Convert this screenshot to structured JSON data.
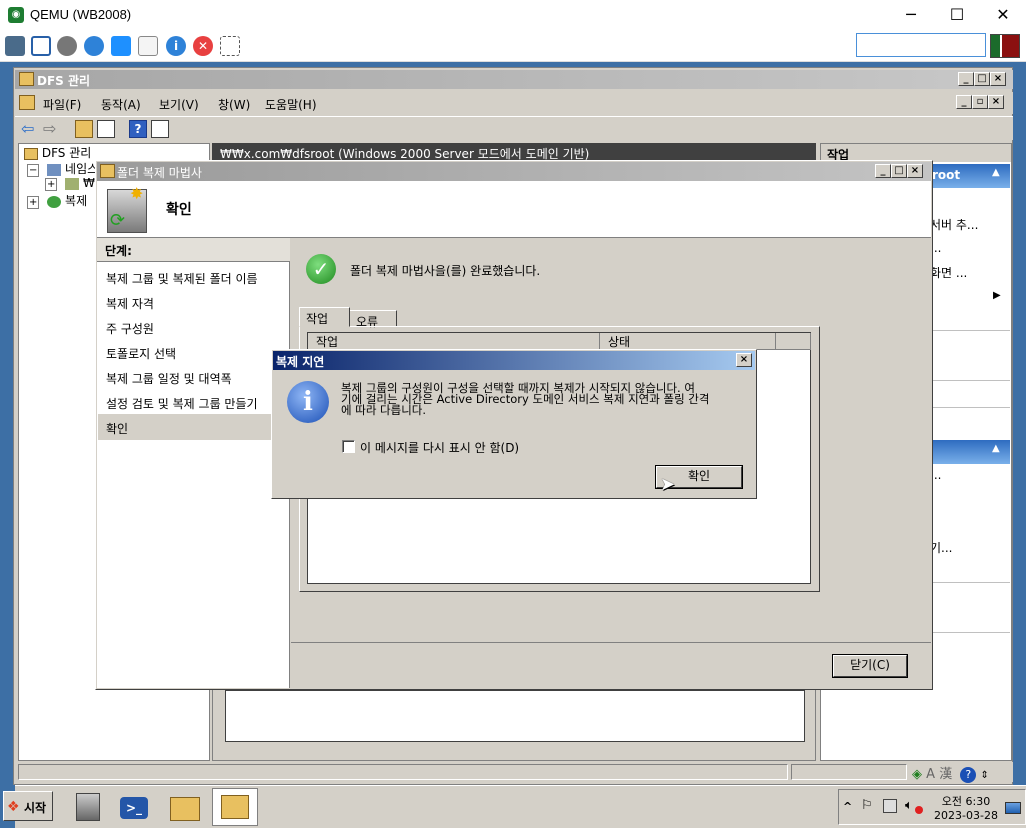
{
  "qemu": {
    "title": "QEMU (WB2008)",
    "window_controls": [
      "─",
      "☐",
      "✕"
    ],
    "toolbar_icons": [
      "network-icon",
      "fullscreen-icon",
      "settings-icon",
      "refresh-icon",
      "windows-icon",
      "usb-icon",
      "info-icon",
      "stop-icon",
      "screenshot-icon"
    ],
    "search_value": ""
  },
  "mmc": {
    "title": "DFS 관리",
    "menu": [
      "파일(F)",
      "동작(A)",
      "보기(V)",
      "창(W)",
      "도움말(H)"
    ],
    "tree": {
      "root": "DFS 관리",
      "namespaces": "네임스",
      "namespace_child": "₩",
      "replication": "복제"
    },
    "center_header": "₩₩x.com₩dfsroot   (Windows 2000 Server 모드에서 도메인 기반)",
    "actions": {
      "header": "작업",
      "band1": "root",
      "items": [
        "서버 추...",
        "...",
        "화면 ...",
        "기..."
      ]
    }
  },
  "wizard": {
    "title": "폴더 복제 마법사",
    "heading": "확인",
    "steps_header": "단계:",
    "steps": [
      "복제 그룹 및 복제된 폴더 이름",
      "복제 자격",
      "주 구성원",
      "토폴로지 선택",
      "복제 그룹 일정 및 대역폭",
      "설정 검토 및 복제 그룹 만들기",
      "확인"
    ],
    "success_message": "폴더 복제 마법사을(를) 완료했습니다.",
    "tabs": [
      "작업",
      "오류"
    ],
    "columns": [
      "작업",
      "상태"
    ],
    "close_button": "닫기(C)"
  },
  "msgbox": {
    "title": "복제 지연",
    "line1": "복제 그룹의 구성원이 구성을 선택할 때까지 복제가 시작되지 않습니다. 여",
    "line2": "기에 걸리는 시간은 Active Directory 도메인 서비스 복제 지연과 폴링 간격",
    "line3": "에 따라 다릅니다.",
    "checkbox_label": "이 메시지를 다시 표시 안 함(D)",
    "checkbox_checked": false,
    "ok_button": "확인"
  },
  "taskbar": {
    "start_label": "시작",
    "clock_time": "오전 6:30",
    "clock_date": "2023-03-28"
  }
}
